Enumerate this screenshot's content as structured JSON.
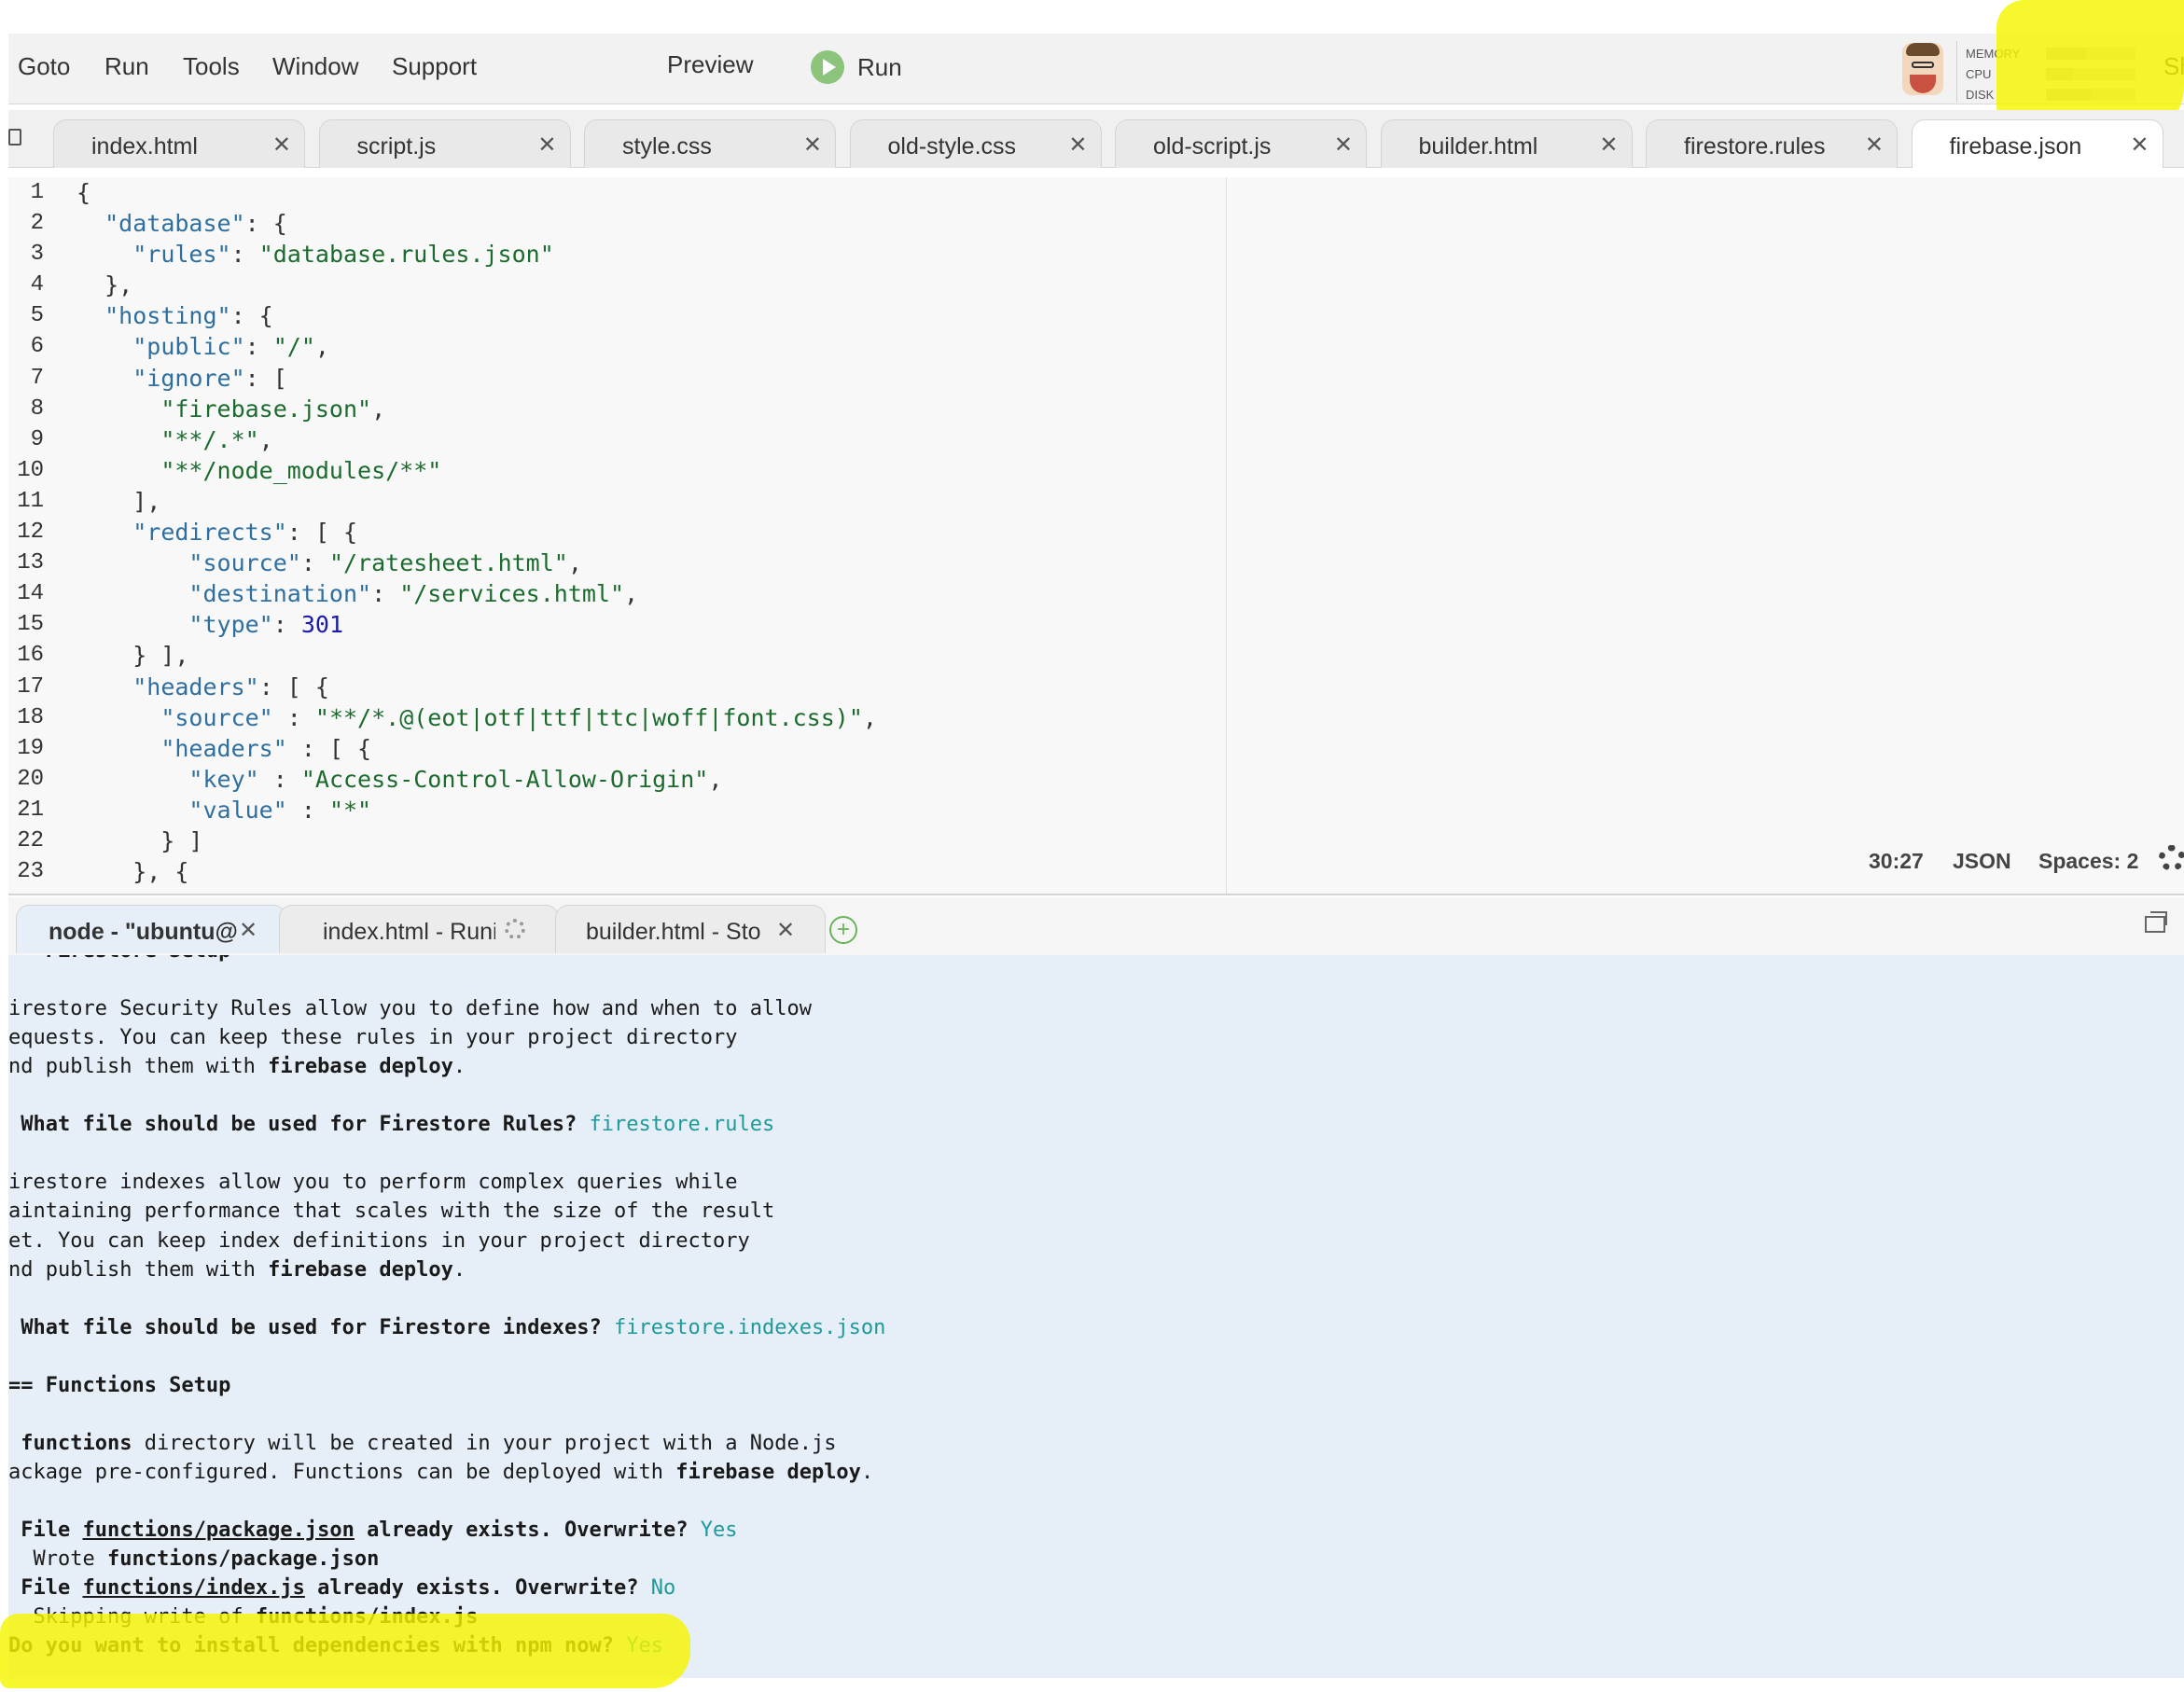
{
  "menu": {
    "items": [
      "Goto",
      "Run",
      "Tools",
      "Window",
      "Support"
    ],
    "preview": "Preview",
    "run": "Run",
    "share": "Sh"
  },
  "meters": [
    {
      "label": "MEMORY",
      "level": 0.45
    },
    {
      "label": "CPU",
      "level": 0.3
    },
    {
      "label": "DISK",
      "level": 0.5
    }
  ],
  "editor_tabs": [
    "index.html",
    "script.js",
    "style.css",
    "old-style.css",
    "old-script.js",
    "builder.html",
    "firestore.rules",
    "firebase.json"
  ],
  "active_tab": "firebase.json",
  "code_lines": [
    [
      {
        "t": "{",
        "c": "p"
      }
    ],
    [
      {
        "t": "  ",
        "c": "p"
      },
      {
        "t": "\"database\"",
        "c": "k"
      },
      {
        "t": ": {",
        "c": "p"
      }
    ],
    [
      {
        "t": "    ",
        "c": "p"
      },
      {
        "t": "\"rules\"",
        "c": "k"
      },
      {
        "t": ": ",
        "c": "p"
      },
      {
        "t": "\"database.rules.json\"",
        "c": "s"
      }
    ],
    [
      {
        "t": "  },",
        "c": "p"
      }
    ],
    [
      {
        "t": "  ",
        "c": "p"
      },
      {
        "t": "\"hosting\"",
        "c": "k"
      },
      {
        "t": ": {",
        "c": "p"
      }
    ],
    [
      {
        "t": "    ",
        "c": "p"
      },
      {
        "t": "\"public\"",
        "c": "k"
      },
      {
        "t": ": ",
        "c": "p"
      },
      {
        "t": "\"/\"",
        "c": "s"
      },
      {
        "t": ",",
        "c": "p"
      }
    ],
    [
      {
        "t": "    ",
        "c": "p"
      },
      {
        "t": "\"ignore\"",
        "c": "k"
      },
      {
        "t": ": [",
        "c": "p"
      }
    ],
    [
      {
        "t": "      ",
        "c": "p"
      },
      {
        "t": "\"firebase.json\"",
        "c": "s"
      },
      {
        "t": ",",
        "c": "p"
      }
    ],
    [
      {
        "t": "      ",
        "c": "p"
      },
      {
        "t": "\"**/.*\"",
        "c": "s"
      },
      {
        "t": ",",
        "c": "p"
      }
    ],
    [
      {
        "t": "      ",
        "c": "p"
      },
      {
        "t": "\"**/node_modules/**\"",
        "c": "s"
      }
    ],
    [
      {
        "t": "    ],",
        "c": "p"
      }
    ],
    [
      {
        "t": "    ",
        "c": "p"
      },
      {
        "t": "\"redirects\"",
        "c": "k"
      },
      {
        "t": ": [ {",
        "c": "p"
      }
    ],
    [
      {
        "t": "        ",
        "c": "p"
      },
      {
        "t": "\"source\"",
        "c": "k"
      },
      {
        "t": ": ",
        "c": "p"
      },
      {
        "t": "\"/ratesheet.html\"",
        "c": "s"
      },
      {
        "t": ",",
        "c": "p"
      }
    ],
    [
      {
        "t": "        ",
        "c": "p"
      },
      {
        "t": "\"destination\"",
        "c": "k"
      },
      {
        "t": ": ",
        "c": "p"
      },
      {
        "t": "\"/services.html\"",
        "c": "s"
      },
      {
        "t": ",",
        "c": "p"
      }
    ],
    [
      {
        "t": "        ",
        "c": "p"
      },
      {
        "t": "\"type\"",
        "c": "k"
      },
      {
        "t": ": ",
        "c": "p"
      },
      {
        "t": "301",
        "c": "n"
      }
    ],
    [
      {
        "t": "    } ],",
        "c": "p"
      }
    ],
    [
      {
        "t": "    ",
        "c": "p"
      },
      {
        "t": "\"headers\"",
        "c": "k"
      },
      {
        "t": ": [ {",
        "c": "p"
      }
    ],
    [
      {
        "t": "      ",
        "c": "p"
      },
      {
        "t": "\"source\"",
        "c": "k"
      },
      {
        "t": " : ",
        "c": "p"
      },
      {
        "t": "\"**/*.@(eot|otf|ttf|ttc|woff|font.css)\"",
        "c": "s"
      },
      {
        "t": ",",
        "c": "p"
      }
    ],
    [
      {
        "t": "      ",
        "c": "p"
      },
      {
        "t": "\"headers\"",
        "c": "k"
      },
      {
        "t": " : [ {",
        "c": "p"
      }
    ],
    [
      {
        "t": "        ",
        "c": "p"
      },
      {
        "t": "\"key\"",
        "c": "k"
      },
      {
        "t": " : ",
        "c": "p"
      },
      {
        "t": "\"Access-Control-Allow-Origin\"",
        "c": "s"
      },
      {
        "t": ",",
        "c": "p"
      }
    ],
    [
      {
        "t": "        ",
        "c": "p"
      },
      {
        "t": "\"value\"",
        "c": "k"
      },
      {
        "t": " : ",
        "c": "p"
      },
      {
        "t": "\"*\"",
        "c": "s"
      }
    ],
    [
      {
        "t": "      } ]",
        "c": "p"
      }
    ],
    [
      {
        "t": "    }, {",
        "c": "p"
      }
    ]
  ],
  "status": {
    "position": "30:27",
    "mode": "JSON",
    "indent": "Spaces: 2"
  },
  "terminal_tabs": [
    "node - \"ubuntu@",
    "index.html - Runi",
    "builder.html - Sto"
  ],
  "terminal_lines": [
    {
      "line": 0,
      "segs": [
        {
          "t": "-- Firestore Setup",
          "b": 1
        }
      ]
    },
    {
      "line": 2,
      "segs": [
        {
          "t": "irestore Security Rules allow you to define how and when to allow"
        }
      ]
    },
    {
      "line": 3,
      "segs": [
        {
          "t": "equests. You can keep these rules in your project directory"
        }
      ]
    },
    {
      "line": 4,
      "segs": [
        {
          "t": "nd publish them with "
        },
        {
          "t": "firebase deploy",
          "b": 1
        },
        {
          "t": "."
        }
      ]
    },
    {
      "line": 6,
      "segs": [
        {
          "t": " What file should be used for Firestore Rules? ",
          "b": 1
        },
        {
          "t": "firestore.rules",
          "a": 1
        }
      ]
    },
    {
      "line": 8,
      "segs": [
        {
          "t": "irestore indexes allow you to perform complex queries while"
        }
      ]
    },
    {
      "line": 9,
      "segs": [
        {
          "t": "aintaining performance that scales with the size of the result"
        }
      ]
    },
    {
      "line": 10,
      "segs": [
        {
          "t": "et. You can keep index definitions in your project directory"
        }
      ]
    },
    {
      "line": 11,
      "segs": [
        {
          "t": "nd publish them with "
        },
        {
          "t": "firebase deploy",
          "b": 1
        },
        {
          "t": "."
        }
      ]
    },
    {
      "line": 13,
      "segs": [
        {
          "t": " What file should be used for Firestore indexes? ",
          "b": 1
        },
        {
          "t": "firestore.indexes.json",
          "a": 1
        }
      ]
    },
    {
      "line": 15,
      "segs": [
        {
          "t": "== Functions Setup",
          "b": 1
        }
      ]
    },
    {
      "line": 17,
      "segs": [
        {
          "t": " "
        },
        {
          "t": "functions",
          "b": 1
        },
        {
          "t": " directory will be created in your project with a Node.js"
        }
      ]
    },
    {
      "line": 18,
      "segs": [
        {
          "t": "ackage pre-configured. Functions can be deployed with "
        },
        {
          "t": "firebase deploy",
          "b": 1
        },
        {
          "t": "."
        }
      ]
    },
    {
      "line": 20,
      "segs": [
        {
          "t": " File ",
          "b": 1
        },
        {
          "t": "functions/package.json",
          "b": 1,
          "u": 1
        },
        {
          "t": " already exists. Overwrite? ",
          "b": 1
        },
        {
          "t": "Yes",
          "a": 1
        }
      ]
    },
    {
      "line": 21,
      "segs": [
        {
          "t": "  Wrote "
        },
        {
          "t": "functions/package.json",
          "b": 1
        }
      ]
    },
    {
      "line": 22,
      "segs": [
        {
          "t": " File ",
          "b": 1
        },
        {
          "t": "functions/index.js",
          "b": 1,
          "u": 1
        },
        {
          "t": " already exists. Overwrite? ",
          "b": 1
        },
        {
          "t": "No",
          "a": 1
        }
      ]
    },
    {
      "line": 23,
      "segs": [
        {
          "t": "  Skipping write of "
        },
        {
          "t": "functions/index.js",
          "b": 1
        }
      ]
    },
    {
      "line": 24,
      "segs": [
        {
          "t": "Do you want to install dependencies with npm now? ",
          "b": 1
        },
        {
          "t": "Yes",
          "a": 1
        }
      ]
    }
  ],
  "colors": {
    "highlight": "#f5f500",
    "run_green": "#8cc47b",
    "answer_teal": "#1e9a9a",
    "terminal_bg": "#e6eef8"
  }
}
